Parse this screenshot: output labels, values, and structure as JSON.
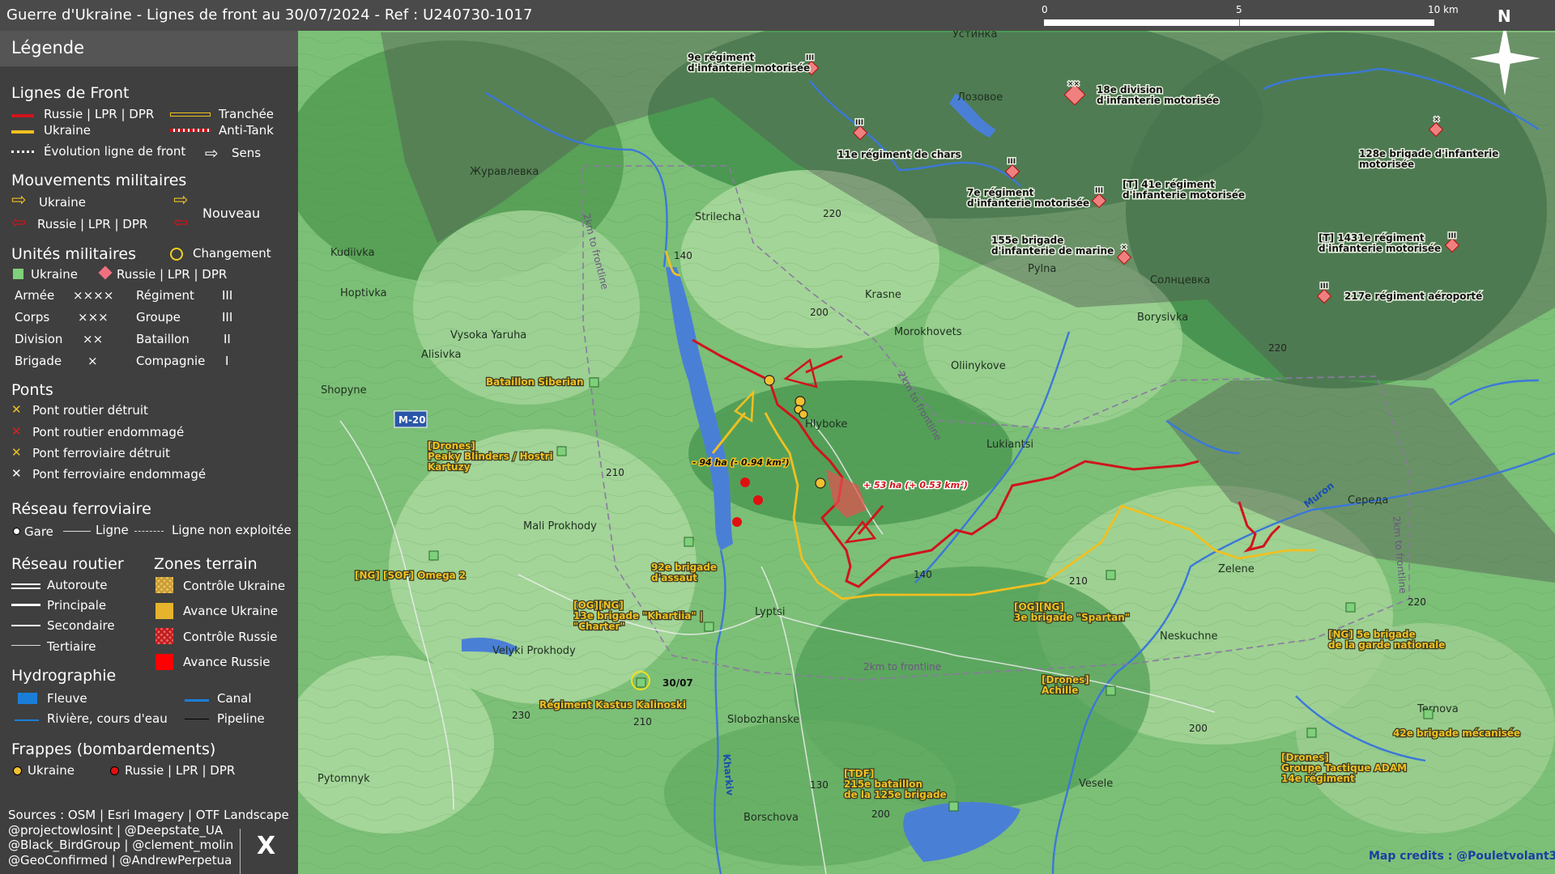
{
  "title": "Guerre d'Ukraine - Lignes de front au 30/07/2024 - Ref : U240730-1017",
  "scalebar": {
    "ticks": [
      "0",
      "5",
      "10 km"
    ]
  },
  "north_label": "N",
  "legend": {
    "heading": "Légende",
    "front_lines": {
      "title": "Lignes de Front",
      "russia": "Russie | LPR | DPR",
      "ukraine": "Ukraine",
      "evolution": "Évolution ligne de front",
      "trench": "Tranchée",
      "antitank": "Anti-Tank",
      "direction": "Sens"
    },
    "movements": {
      "title": "Mouvements militaires",
      "ukraine": "Ukraine",
      "russia": "Russie | LPR | DPR",
      "new": "Nouveau"
    },
    "units": {
      "title": "Unités militaires",
      "change": "Changement",
      "ukraine": "Ukraine",
      "russia": "Russie | LPR | DPR",
      "rows": [
        {
          "a": "Armée",
          "as": "××××",
          "b": "Régiment",
          "bs": "III"
        },
        {
          "a": "Corps",
          "as": "×××",
          "b": "Groupe",
          "bs": "III"
        },
        {
          "a": "Division",
          "as": "××",
          "b": "Bataillon",
          "bs": "II"
        },
        {
          "a": "Brigade",
          "as": "×",
          "b": "Compagnie",
          "bs": "I"
        }
      ]
    },
    "bridges": {
      "title": "Ponts",
      "items": [
        "Pont routier détruit",
        "Pont routier endommagé",
        "Pont ferroviaire détruit",
        "Pont ferroviaire endommagé"
      ]
    },
    "rail": {
      "title": "Réseau ferroviaire",
      "station": "Gare",
      "line": "Ligne",
      "unused": "Ligne non exploitée"
    },
    "roads": {
      "title": "Réseau routier",
      "items": [
        "Autoroute",
        "Principale",
        "Secondaire",
        "Tertiaire"
      ]
    },
    "zones": {
      "title": "Zones terrain",
      "items": [
        "Contrôle Ukraine",
        "Avance Ukraine",
        "Contrôle Russie",
        "Avance Russie"
      ]
    },
    "hydro": {
      "title": "Hydrographie",
      "river_big": "Fleuve",
      "river": "Rivière, cours d'eau",
      "canal": "Canal",
      "pipeline": "Pipeline"
    },
    "strikes": {
      "title": "Frappes (bombardements)",
      "ukraine": "Ukraine",
      "russia": "Russie | LPR | DPR"
    },
    "sources": "Sources : OSM | Esri Imagery | OTF Landscape\n@projectowlosint | @Deepstate_UA\n@Black_BirdGroup | @clement_molin\n@GeoConfirmed | @AndrewPerpetua",
    "x_logo": "X"
  },
  "colors": {
    "russia": "#d0141c",
    "ukraine": "#f0c020",
    "water": "#4a7fd6",
    "map_green": "#5fae63"
  },
  "places": [
    "Устинка",
    "Лозовое",
    "Журавлевка",
    "Strilecha",
    "Kudiivka",
    "Hoptivka",
    "Krasne",
    "Morokhovets",
    "Vysoka Yaruha",
    "Alisivka",
    "Pylna",
    "Солнцевка",
    "Borysivka",
    "Oliinykove",
    "Shopyne",
    "Hlyboke",
    "Lukiantsi",
    "Середа",
    "Mali Prokhody",
    "Zelene",
    "Lyptsi",
    "Neskuchne",
    "Velyki Prokhody",
    "Slobozhanske",
    "Ternova",
    "Pytomnyk",
    "Veselе",
    "Borschova"
  ],
  "road_label": "M-20",
  "river_labels": [
    "Muron",
    "Kharkiv"
  ],
  "frontline_labels": [
    "2km to frontline",
    "2km to frontline",
    "2km to frontline",
    "2km to frontline"
  ],
  "elevations": [
    "220",
    "140",
    "200",
    "210",
    "140",
    "210",
    "220",
    "220",
    "230",
    "210",
    "130",
    "200",
    "200"
  ],
  "changes": {
    "ukraine": "- 94 ha (- 0.94 km²)",
    "russia": "+ 53 ha (+ 0.53 km²)"
  },
  "units_ru": [
    {
      "label": "9e régiment\nd'infanterie motorisée",
      "echelon": "III"
    },
    {
      "label": "18e division\nd'infanterie motorisée",
      "echelon": "××"
    },
    {
      "label": "11e régiment de chars",
      "echelon": "III"
    },
    {
      "label": "128e brigade d'infanterie\nmotorisée",
      "echelon": "×"
    },
    {
      "label": "7e régiment\nd'infanterie motorisée",
      "echelon": "III"
    },
    {
      "label": "[T] 41e régiment\nd'infanterie motorisée",
      "echelon": "III"
    },
    {
      "label": "155e brigade\nd'infanterie de marine",
      "echelon": "×"
    },
    {
      "label": "[T] 1431e régiment\nd'infanterie motorisée",
      "echelon": "III"
    },
    {
      "label": "217e régiment aéroporté",
      "echelon": "III"
    }
  ],
  "units_ua": [
    {
      "label": "Bataillon Siberian"
    },
    {
      "label": "[Drones]\nPeaky Blinders / Hostri\nKartuzy"
    },
    {
      "label": "[NG] [SOF] Omega 2"
    },
    {
      "label": "92e brigade\nd'assaut"
    },
    {
      "label": "[OG][NG]\n13e brigade \"Khartiia\" |\n\"Charter\""
    },
    {
      "label": "Régiment Kastus Kalinoski"
    },
    {
      "label": "[OG][NG]\n3e brigade \"Spartan\""
    },
    {
      "label": "[NG] 5e brigade\nde la garde nationale"
    },
    {
      "label": "[Drones]\nAchille"
    },
    {
      "label": "42e brigade mécanisée"
    },
    {
      "label": "[Drones]\nGroupe Tactique ADAM\n14e régiment"
    },
    {
      "label": "[TDF]\n215e bataillon\nde la 125e brigade"
    }
  ],
  "kalinoski_date": "30/07",
  "credits": "Map credits : @Pouletvolant3"
}
